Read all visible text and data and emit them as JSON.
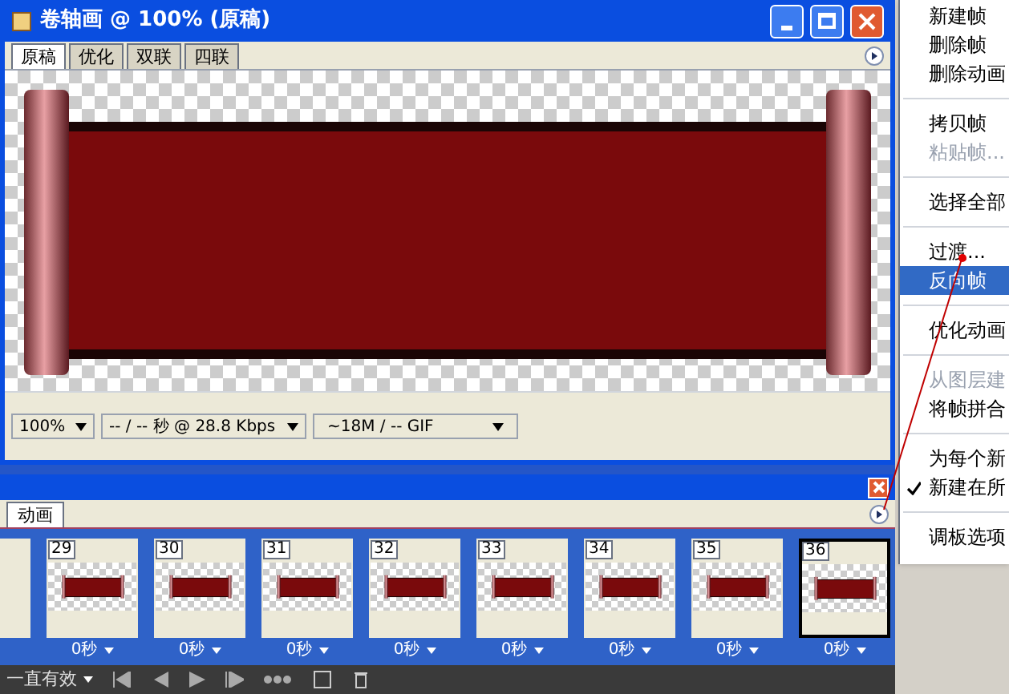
{
  "document_window": {
    "title": "卷轴画 @ 100% (原稿)",
    "tabs": [
      {
        "label": "原稿",
        "selected": true
      },
      {
        "label": "优化",
        "selected": false
      },
      {
        "label": "双联",
        "selected": false
      },
      {
        "label": "四联",
        "selected": false
      }
    ],
    "status_bar": {
      "zoom": "100%",
      "download_time": "-- / -- 秒 @ 28.8 Kbps",
      "size": "~18M / -- GIF"
    }
  },
  "animation_palette": {
    "tabs": [
      {
        "label": "动画",
        "selected": true
      }
    ],
    "frames": [
      {
        "number": "29",
        "delay": "0秒",
        "selected": false
      },
      {
        "number": "30",
        "delay": "0秒",
        "selected": false
      },
      {
        "number": "31",
        "delay": "0秒",
        "selected": false
      },
      {
        "number": "32",
        "delay": "0秒",
        "selected": false
      },
      {
        "number": "33",
        "delay": "0秒",
        "selected": false
      },
      {
        "number": "34",
        "delay": "0秒",
        "selected": false
      },
      {
        "number": "35",
        "delay": "0秒",
        "selected": false
      },
      {
        "number": "36",
        "delay": "0秒",
        "selected": true
      }
    ],
    "loop": "一直有效"
  },
  "menu": {
    "items": [
      {
        "kind": "item",
        "label": "新建帧",
        "disabled": false,
        "checked": false,
        "selected": false
      },
      {
        "kind": "item",
        "label": "删除帧",
        "disabled": false,
        "checked": false,
        "selected": false
      },
      {
        "kind": "item",
        "label": "删除动画",
        "disabled": false,
        "checked": false,
        "selected": false
      },
      {
        "kind": "separator"
      },
      {
        "kind": "item",
        "label": "拷贝帧",
        "disabled": false,
        "checked": false,
        "selected": false
      },
      {
        "kind": "item",
        "label": "粘贴帧...",
        "disabled": true,
        "checked": false,
        "selected": false
      },
      {
        "kind": "separator"
      },
      {
        "kind": "item",
        "label": "选择全部",
        "disabled": false,
        "checked": false,
        "selected": false
      },
      {
        "kind": "separator"
      },
      {
        "kind": "item",
        "label": "过渡...",
        "disabled": false,
        "checked": false,
        "selected": false
      },
      {
        "kind": "item",
        "label": "反向帧",
        "disabled": false,
        "checked": false,
        "selected": true
      },
      {
        "kind": "separator"
      },
      {
        "kind": "item",
        "label": "优化动画",
        "disabled": false,
        "checked": false,
        "selected": false
      },
      {
        "kind": "separator"
      },
      {
        "kind": "item",
        "label": "从图层建",
        "disabled": true,
        "checked": false,
        "selected": false
      },
      {
        "kind": "item",
        "label": "将帧拼合",
        "disabled": false,
        "checked": false,
        "selected": false
      },
      {
        "kind": "separator"
      },
      {
        "kind": "item",
        "label": "为每个新",
        "disabled": false,
        "checked": false,
        "selected": false
      },
      {
        "kind": "item",
        "label": "新建在所",
        "disabled": false,
        "checked": true,
        "selected": false
      },
      {
        "kind": "separator"
      },
      {
        "kind": "item",
        "label": "调板选项",
        "disabled": false,
        "checked": false,
        "selected": false
      }
    ]
  }
}
